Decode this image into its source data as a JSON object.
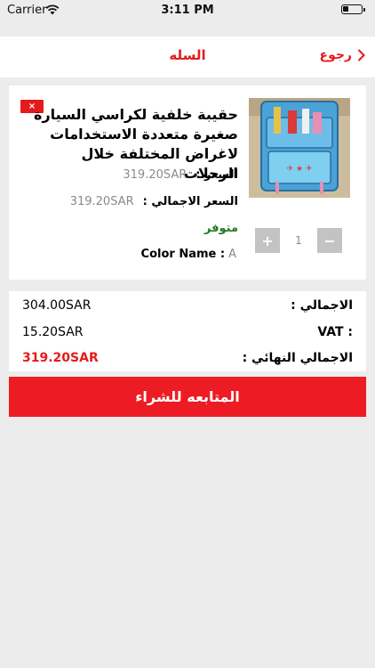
{
  "status_bar": {
    "carrier": "Carrier",
    "time": "3:11 PM"
  },
  "nav": {
    "title": "السله",
    "back_label": "رجوع"
  },
  "product": {
    "remove_icon": "×",
    "title": "حقيبة خلفية لكراسي السيارة صغيرة متعددة الاستخدامات لاغراض المختلفة خلال الرحلات",
    "price_label": "السعر :",
    "price_value": "319.20SAR",
    "total_label": "السعر الاجمالي :",
    "total_value": "319.20SAR",
    "availability": "متوفر",
    "color_label": "Color Name :",
    "color_value": "A",
    "quantity": "1",
    "plus_symbol": "+",
    "minus_symbol": "−"
  },
  "totals": {
    "subtotal_label": "الاجمالي :",
    "subtotal_value": "304.00SAR",
    "vat_label": "VAT :",
    "vat_value": "15.20SAR",
    "final_label": "الاجمالي النهائي :",
    "final_value": "319.20SAR"
  },
  "checkout": {
    "label": "المتابعه للشراء"
  },
  "colors": {
    "accent": "#e51b1b",
    "available": "#1f7a1f",
    "background": "#ececec"
  }
}
